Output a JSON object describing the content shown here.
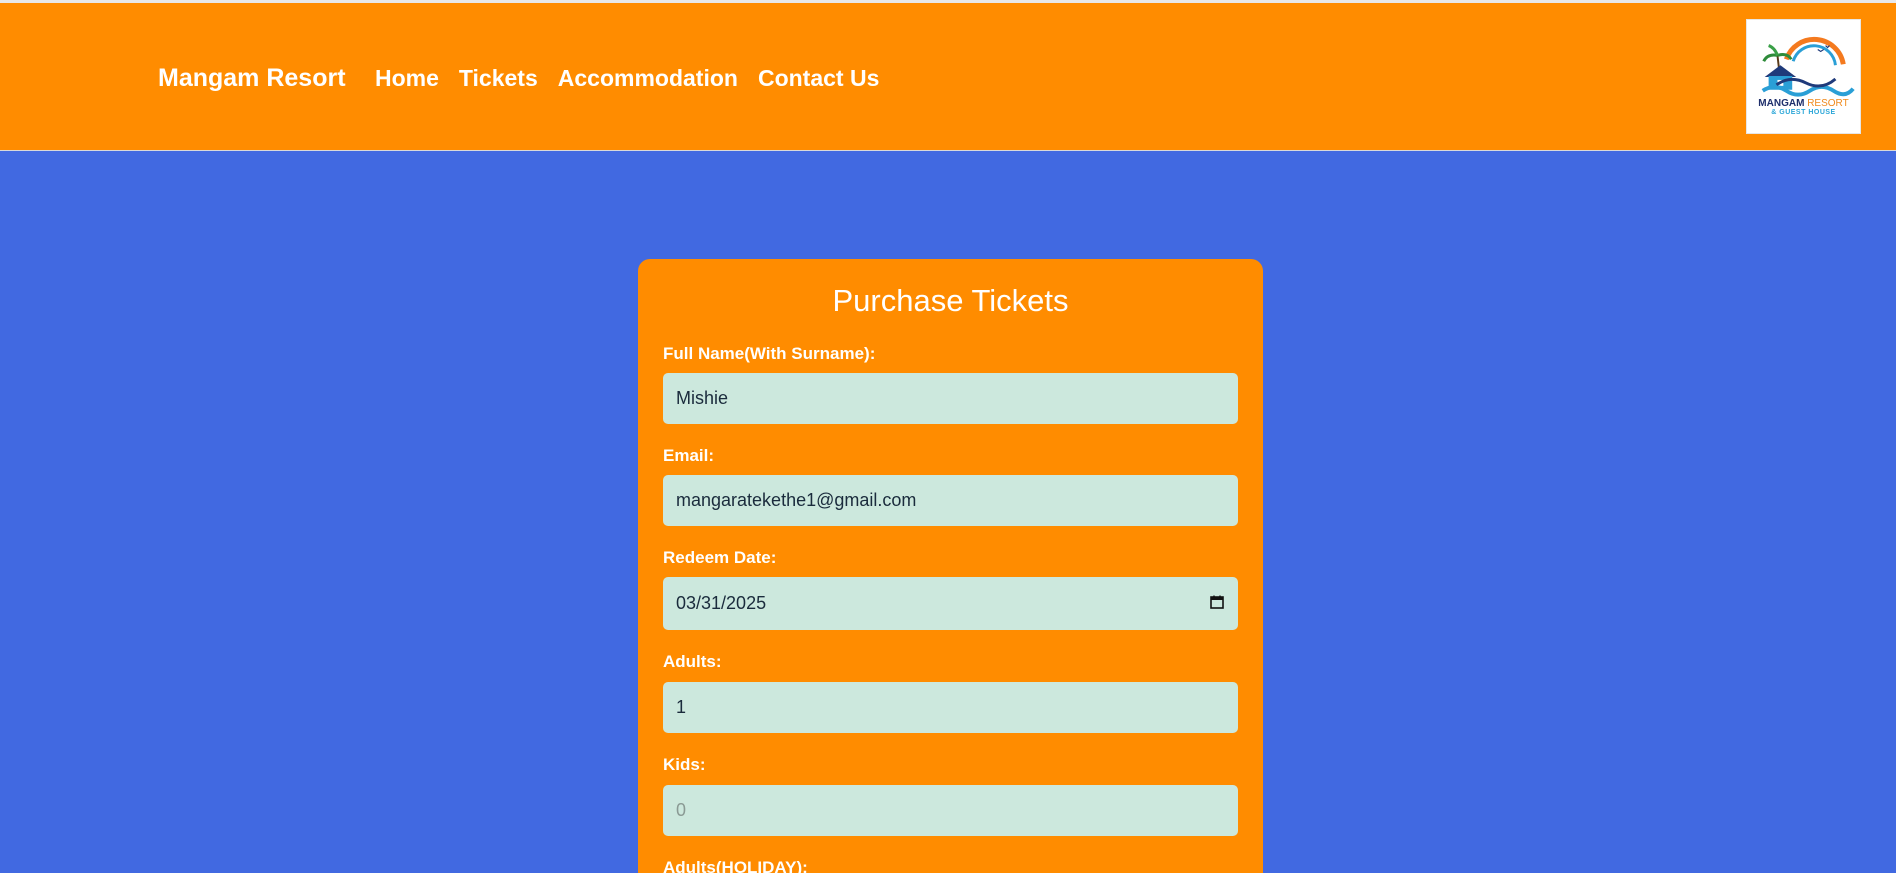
{
  "navbar": {
    "brand": "Mangam Resort",
    "links": [
      "Home",
      "Tickets",
      "Accommodation",
      "Contact Us"
    ],
    "logo_name": "MANGAM",
    "logo_accent": "RESORT",
    "logo_sub": "& GUEST HOUSE"
  },
  "form": {
    "title": "Purchase Tickets",
    "full_name": {
      "label": "Full Name(With Surname):",
      "value": "Mishie"
    },
    "email": {
      "label": "Email:",
      "value": "mangaratekethe1@gmail.com"
    },
    "redeem_date": {
      "label": "Redeem Date:",
      "value": "03/31/2025"
    },
    "adults": {
      "label": "Adults:",
      "value": "1"
    },
    "kids": {
      "label": "Kids:",
      "placeholder": "0"
    },
    "adults_holiday": {
      "label": "Adults(HOLIDAY):"
    }
  },
  "colors": {
    "page_background": "#4169e1",
    "navbar": "#ff8c00",
    "card": "#ff8c00",
    "input": "#cce8dd",
    "text_white": "#ffffff"
  },
  "icons": [
    "calendar-icon"
  ]
}
